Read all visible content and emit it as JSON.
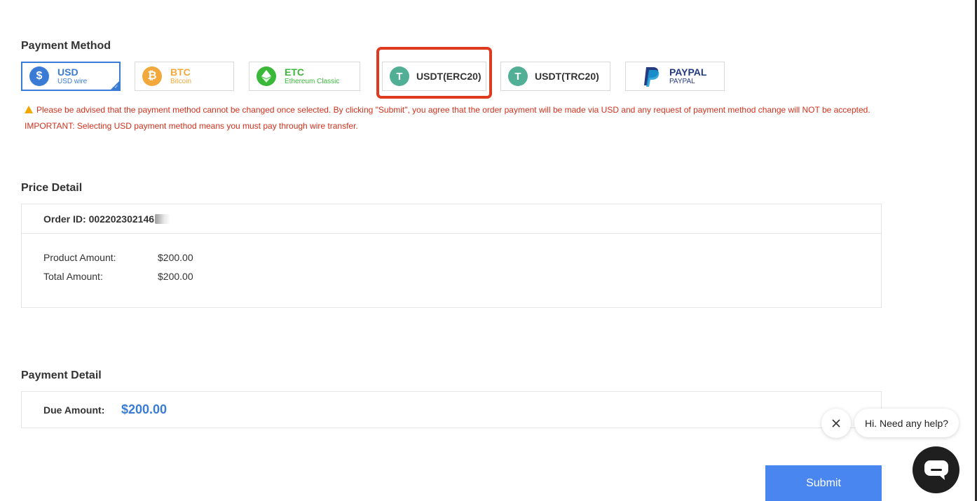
{
  "payment_method": {
    "title": "Payment Method",
    "options": [
      {
        "name": "USD",
        "sub": "USD wire",
        "icon": "dollar-coin-icon",
        "color": "#3a7bd5",
        "selected": true
      },
      {
        "name": "BTC",
        "sub": "Bitcoin",
        "icon": "bitcoin-icon",
        "color": "#f2a83b"
      },
      {
        "name": "ETC",
        "sub": "Ethereum Classic",
        "icon": "ethereum-classic-icon",
        "color": "#3ab83a"
      },
      {
        "name": "USDT(ERC20)",
        "icon": "tether-icon",
        "icon_label": "ERC20",
        "color": "#50af95",
        "highlighted": true
      },
      {
        "name": "USDT(TRC20)",
        "icon": "tether-icon",
        "icon_label": "TRC20",
        "color": "#50af95"
      },
      {
        "name": "PAYPAL",
        "sub": "PAYPAL",
        "icon": "paypal-icon",
        "color": "#253b80"
      }
    ],
    "notice_line1": "Please be advised that the payment method cannot be changed once selected. By clicking \"Submit\", you agree that the order payment will be made via USD and any request of payment method change will NOT be accepted.",
    "notice_line2": "IMPORTANT: Selecting USD payment method means you must pay through wire transfer."
  },
  "price_detail": {
    "title": "Price Detail",
    "order_id_label": "Order ID:",
    "order_id": "002202302146",
    "product_amount_label": "Product Amount:",
    "product_amount": "$200.00",
    "total_amount_label": "Total Amount:",
    "total_amount": "$200.00"
  },
  "payment_detail": {
    "title": "Payment Detail",
    "due_label": "Due Amount:",
    "due_amount": "$200.00"
  },
  "submit_label": "Submit",
  "chat": {
    "bubble_text": "Hi. Need any help?"
  },
  "colors": {
    "accent": "#3a7bd5",
    "warning": "#d0311c",
    "highlight_box": "#e03a1e",
    "submit": "#4a86f0"
  }
}
